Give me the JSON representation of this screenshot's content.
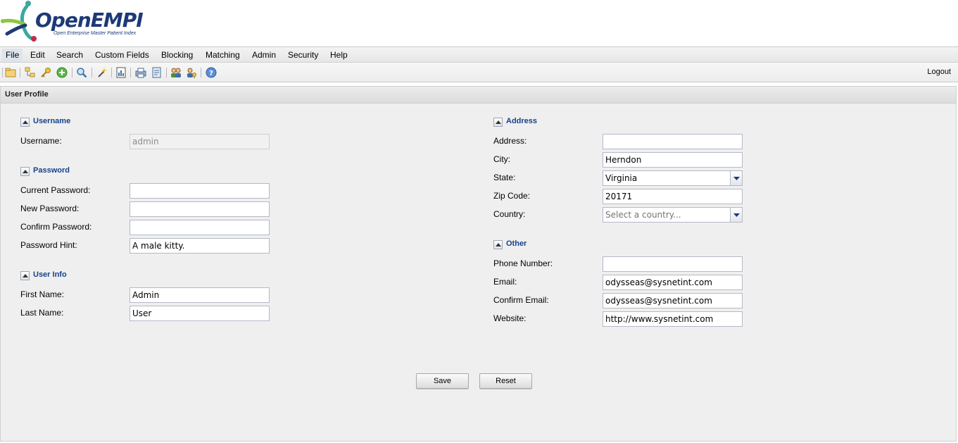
{
  "app": {
    "logo_title": "OpenEMPI",
    "logo_subtitle": "Open Enterprise Master Patient Index"
  },
  "menu": [
    "File",
    "Edit",
    "Search",
    "Custom Fields",
    "Blocking",
    "Matching",
    "Admin",
    "Security",
    "Help"
  ],
  "toolbar": {
    "icons": [
      "open-folder-icon",
      "tree-icon",
      "key-icon",
      "add-icon",
      "search-icon",
      "wand-icon",
      "report-icon",
      "print-icon",
      "document-icon",
      "users-icon",
      "user-key-icon",
      "help-icon"
    ],
    "logout_label": "Logout"
  },
  "panel": {
    "title": "User Profile"
  },
  "sections": {
    "username": {
      "title": "Username",
      "username_label": "Username:",
      "username_value": "admin"
    },
    "password": {
      "title": "Password",
      "current_label": "Current Password:",
      "current_value": "",
      "new_label": "New Password:",
      "new_value": "",
      "confirm_label": "Confirm Password:",
      "confirm_value": "",
      "hint_label": "Password Hint:",
      "hint_value": "A male kitty."
    },
    "user_info": {
      "title": "User Info",
      "first_label": "First Name:",
      "first_value": "Admin",
      "last_label": "Last Name:",
      "last_value": "User"
    },
    "address": {
      "title": "Address",
      "address_label": "Address:",
      "address_value": "",
      "city_label": "City:",
      "city_value": "Herndon",
      "state_label": "State:",
      "state_value": "Virginia",
      "zip_label": "Zip Code:",
      "zip_value": "20171",
      "country_label": "Country:",
      "country_placeholder": "Select a country..."
    },
    "other": {
      "title": "Other",
      "phone_label": "Phone Number:",
      "phone_value": "",
      "email_label": "Email:",
      "email_value": "odysseas@sysnetint.com",
      "confirm_email_label": "Confirm Email:",
      "confirm_email_value": "odysseas@sysnetint.com",
      "website_label": "Website:",
      "website_value": "http://www.sysnetint.com"
    }
  },
  "buttons": {
    "save": "Save",
    "reset": "Reset"
  },
  "colors": {
    "section_title": "#15428b",
    "panel_bg": "#efefef",
    "logo_blue": "#1d3a78",
    "logo_teal": "#3aa9a0",
    "logo_red": "#c42a4b",
    "logo_green": "#8cc63f"
  }
}
